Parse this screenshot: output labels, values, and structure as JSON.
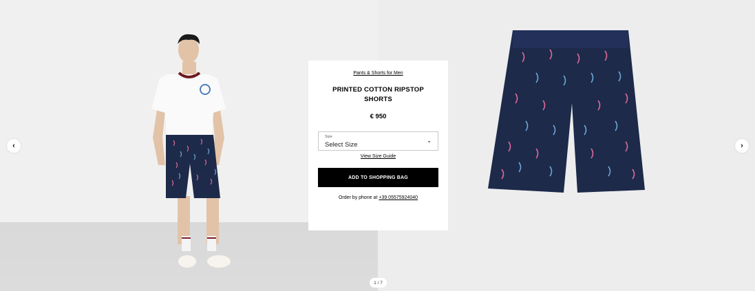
{
  "product": {
    "breadcrumb": "Pants & Shorts for Men",
    "title": "PRINTED COTTON RIPSTOP SHORTS",
    "price": "€ 950",
    "size": {
      "label": "Size",
      "value": "Select Size"
    },
    "size_guide": "View Size Guide",
    "add_to_bag": "ADD TO SHOPPING BAG",
    "order_phone_prefix": "Order by phone at",
    "order_phone_number": "+39 05575924040"
  },
  "gallery": {
    "pager": "1 / 7",
    "prev_icon": "chevron-left-icon",
    "next_icon": "chevron-right-icon"
  },
  "colors": {
    "shorts_navy": "#1d2a4a",
    "pattern_pink": "#e06a9a",
    "pattern_blue": "#6ea9d8",
    "button_black": "#000000"
  }
}
